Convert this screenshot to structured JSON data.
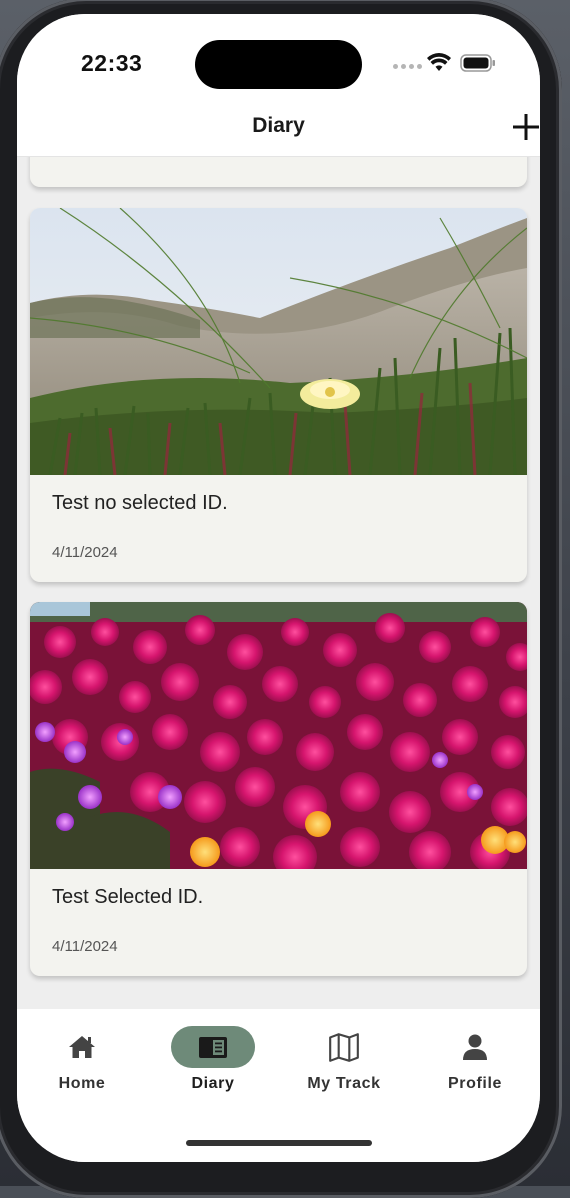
{
  "status_bar": {
    "time": "22:33"
  },
  "header": {
    "title": "Diary"
  },
  "entries": [
    {
      "title": "Test no selected ID.",
      "date": "4/11/2024",
      "image": "dune grass with yellow ice plant flower"
    },
    {
      "title": "Test Selected ID.",
      "date": "4/11/2024",
      "image": "field of magenta ice plant flowers"
    }
  ],
  "tab_bar": {
    "active_tab": "Diary",
    "active_color": "#6e8a79",
    "items": [
      {
        "label": "Home",
        "icon": "home-icon"
      },
      {
        "label": "Diary",
        "icon": "diary-book-icon"
      },
      {
        "label": "My Track",
        "icon": "map-icon"
      },
      {
        "label": "Profile",
        "icon": "person-icon"
      }
    ]
  }
}
